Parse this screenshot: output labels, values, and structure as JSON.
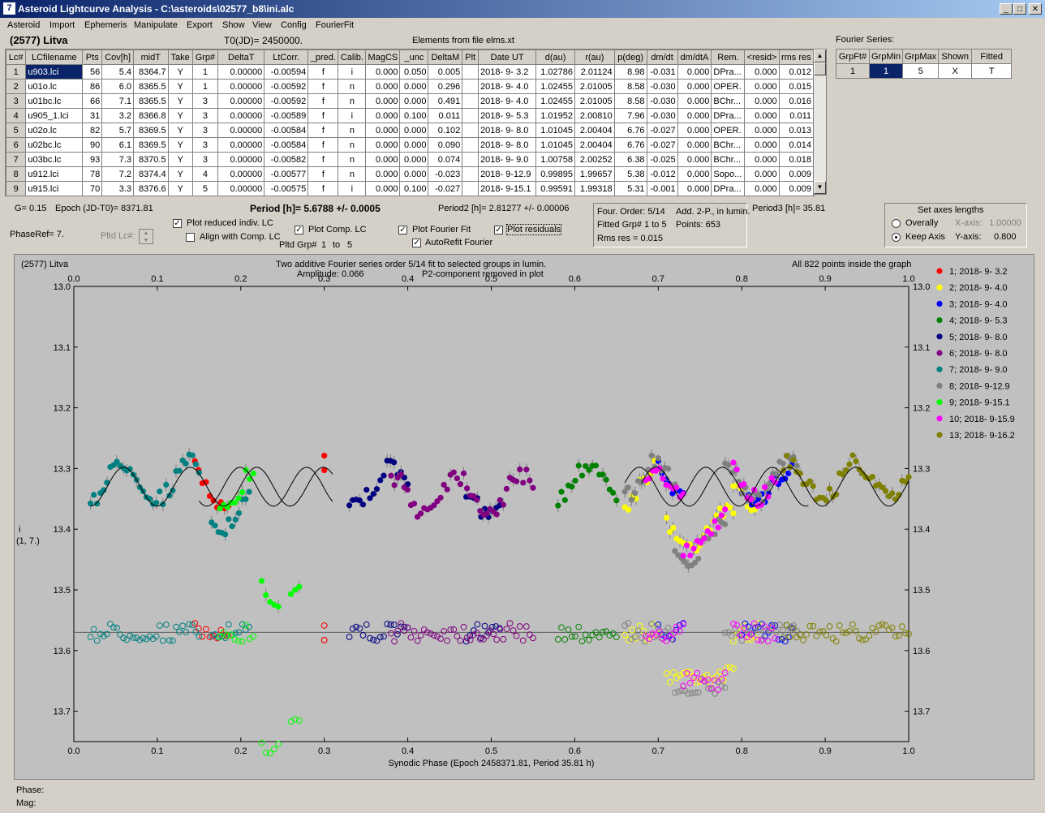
{
  "window": {
    "title": "Asteroid Lightcurve Analysis - C:\\asteroids\\02577_b8\\ini.alc",
    "icon": "7"
  },
  "menu": [
    "Asteroid",
    "Import",
    "Ephemeris",
    "Manipulate",
    "Export",
    "Show",
    "View",
    "Config",
    "FourierFit"
  ],
  "header": {
    "asteroid": "(2577) Litva",
    "t0": "T0(JD)= 2450000.",
    "elements": "Elements from file elms.xt",
    "fourier_label": "Fourier Series:"
  },
  "lc_table": {
    "columns": [
      "Lc#",
      "LCfilename",
      "Pts",
      "Cov[h]",
      "midT",
      "Take",
      "Grp#",
      "DeltaT",
      "LtCorr.",
      "_pred.",
      "Calib.",
      "MagCS",
      "_unc",
      "DeltaM",
      "Plt",
      "Date UT",
      "d(au)",
      "r(au)",
      "p(deg)",
      "dm/dt",
      "dm/dtA",
      "Rem.",
      "<resid>",
      "rms res"
    ],
    "rows": [
      [
        "1",
        "u903.lci",
        "56",
        "5.4",
        "8364.7",
        "Y",
        "1",
        "0.00000",
        "-0.00594",
        "f",
        "i",
        "0.000",
        "0.050",
        "0.005",
        "",
        "2018- 9- 3.2",
        "1.02786",
        "2.01124",
        "8.98",
        "-0.031",
        "0.000",
        "DPra...",
        "0.000",
        "0.012"
      ],
      [
        "2",
        "u01o.lc",
        "86",
        "6.0",
        "8365.5",
        "Y",
        "1",
        "0.00000",
        "-0.00592",
        "f",
        "n",
        "0.000",
        "0.000",
        "0.296",
        "",
        "2018- 9- 4.0",
        "1.02455",
        "2.01005",
        "8.58",
        "-0.030",
        "0.000",
        "OPER.",
        "0.000",
        "0.015"
      ],
      [
        "3",
        "u01bc.lc",
        "66",
        "7.1",
        "8365.5",
        "Y",
        "3",
        "0.00000",
        "-0.00592",
        "f",
        "n",
        "0.000",
        "0.000",
        "0.491",
        "",
        "2018- 9- 4.0",
        "1.02455",
        "2.01005",
        "8.58",
        "-0.030",
        "0.000",
        "BChr...",
        "0.000",
        "0.016"
      ],
      [
        "4",
        "u905_1.lci",
        "31",
        "3.2",
        "8366.8",
        "Y",
        "3",
        "0.00000",
        "-0.00589",
        "f",
        "i",
        "0.000",
        "0.100",
        "0.011",
        "",
        "2018- 9- 5.3",
        "1.01952",
        "2.00810",
        "7.96",
        "-0.030",
        "0.000",
        "DPra...",
        "0.000",
        "0.011"
      ],
      [
        "5",
        "u02o.lc",
        "82",
        "5.7",
        "8369.5",
        "Y",
        "3",
        "0.00000",
        "-0.00584",
        "f",
        "n",
        "0.000",
        "0.000",
        "0.102",
        "",
        "2018- 9- 8.0",
        "1.01045",
        "2.00404",
        "6.76",
        "-0.027",
        "0.000",
        "OPER.",
        "0.000",
        "0.013"
      ],
      [
        "6",
        "u02bc.lc",
        "90",
        "6.1",
        "8369.5",
        "Y",
        "3",
        "0.00000",
        "-0.00584",
        "f",
        "n",
        "0.000",
        "0.000",
        "0.090",
        "",
        "2018- 9- 8.0",
        "1.01045",
        "2.00404",
        "6.76",
        "-0.027",
        "0.000",
        "BChr...",
        "0.000",
        "0.014"
      ],
      [
        "7",
        "u03bc.lc",
        "93",
        "7.3",
        "8370.5",
        "Y",
        "3",
        "0.00000",
        "-0.00582",
        "f",
        "n",
        "0.000",
        "0.000",
        "0.074",
        "",
        "2018- 9- 9.0",
        "1.00758",
        "2.00252",
        "6.38",
        "-0.025",
        "0.000",
        "BChr...",
        "0.000",
        "0.018"
      ],
      [
        "8",
        "u912.lci",
        "78",
        "7.2",
        "8374.4",
        "Y",
        "4",
        "0.00000",
        "-0.00577",
        "f",
        "n",
        "0.000",
        "0.000",
        "-0.023",
        "",
        "2018- 9-12.9",
        "0.99895",
        "1.99657",
        "5.38",
        "-0.012",
        "0.000",
        "Sopo...",
        "0.000",
        "0.009"
      ],
      [
        "9",
        "u915.lci",
        "70",
        "3.3",
        "8376.6",
        "Y",
        "5",
        "0.00000",
        "-0.00575",
        "f",
        "i",
        "0.000",
        "0.100",
        "-0.027",
        "",
        "2018- 9-15.1",
        "0.99591",
        "1.99318",
        "5.31",
        "-0.001",
        "0.000",
        "DPra...",
        "0.000",
        "0.009"
      ]
    ]
  },
  "fourier_table": {
    "columns": [
      "GrpFt#",
      "GrpMin",
      "GrpMax",
      "Shown",
      "Fitted"
    ],
    "row": [
      "1",
      "1",
      "5",
      "X",
      "T"
    ]
  },
  "info": {
    "g": "G= 0.15",
    "epoch": "Epoch (JD-T0)= 8371.81",
    "period": "Period [h]= 5.6788 +/- 0.0005",
    "period2": "Period2 [h]= 2.81277 +/- 0.00006",
    "period3": "Period3 [h]= 35.81",
    "phaseref": "PhaseRef= 7.",
    "pltd_lc": "Pltd Lc#:",
    "pltd_grp": "Pltd Grp#",
    "pltd_grp_from": "1",
    "pltd_grp_to_label": "to",
    "pltd_grp_to": "5"
  },
  "checkboxes": {
    "plot_reduced": {
      "label": "Plot reduced indiv. LC",
      "checked": true
    },
    "align_comp": {
      "label": "Align with Comp. LC",
      "checked": false
    },
    "plot_comp": {
      "label": "Plot Comp. LC",
      "checked": true
    },
    "plot_fourier": {
      "label": "Plot Fourier Fit",
      "checked": true
    },
    "autorefit": {
      "label": "AutoRefit Fourier",
      "checked": true
    },
    "plot_resid": {
      "label": "Plot residuals",
      "checked": true
    }
  },
  "fourier_info": {
    "order": "Four. Order:  5/14",
    "add": "Add. 2-P., in lumin.",
    "fitted": "Fitted Grp# 1 to 5",
    "points": "Points: 653",
    "rms": "Rms res     = 0.015"
  },
  "axes_box": {
    "title": "Set axes lengths",
    "overall": "Overally",
    "keep": "Keep Axis",
    "xlabel": "X-axis:",
    "xval": "1.00000",
    "ylabel": "Y-axis:",
    "yval": "0.800",
    "selected": "keep"
  },
  "plot": {
    "title_left": "(2577) Litva",
    "title_center1": "Two additive Fourier series order 5/14 fit to selected groups in lumin.",
    "title_center2a": "Amplitude: 0.066",
    "title_center2b": "P2-component removed in plot",
    "title_right": "All 822 points inside the graph",
    "ylabel1": "i",
    "ylabel2": "(1, 7.)",
    "phase_label": "Phase:",
    "mag_label": "Mag:"
  },
  "chart_data": {
    "type": "scatter",
    "xlabel": "Synodic Phase (Epoch 2458371.81, Period 35.81 h)",
    "xlim": [
      0.0,
      1.0
    ],
    "ylim": [
      13.0,
      13.75
    ],
    "y_inverted": true,
    "x_ticks": [
      0.0,
      0.1,
      0.2,
      0.3,
      0.4,
      0.5,
      0.6,
      0.7,
      0.8,
      0.9,
      1.0
    ],
    "x_tick_labels": [
      "0.0",
      "0.1",
      "0.2",
      "0.3",
      "0.4",
      "0.5",
      "0.6",
      "0.7",
      "0.8",
      "0.9",
      "1.0"
    ],
    "y_ticks": [
      13.0,
      13.1,
      13.2,
      13.3,
      13.4,
      13.5,
      13.6,
      13.7
    ],
    "y_tick_labels": [
      "13.0",
      "13.1",
      "13.2",
      "13.3",
      "13.4",
      "13.5",
      "13.6",
      "13.7"
    ],
    "residual_baseline": 13.57,
    "legend_placement": "right",
    "series": [
      {
        "name": "1; 2018- 9- 3.2",
        "color": "#ff0000",
        "ranges": [
          [
            0.145,
            0.185,
            13.33
          ],
          [
            0.3,
            0.3,
            13.32
          ]
        ]
      },
      {
        "name": "2; 2018- 9- 4.0",
        "color": "#ffff00",
        "ranges": [
          [
            0.66,
            0.7,
            13.33
          ],
          [
            0.71,
            0.79,
            13.4
          ],
          [
            0.79,
            0.82,
            13.33
          ]
        ]
      },
      {
        "name": "3; 2018- 9- 4.0",
        "color": "#0000ff",
        "ranges": [
          [
            0.7,
            0.73,
            13.33
          ],
          [
            0.8,
            0.86,
            13.33
          ]
        ]
      },
      {
        "name": "4; 2018- 9- 5.3",
        "color": "#008000",
        "ranges": [
          [
            0.58,
            0.65,
            13.32
          ]
        ]
      },
      {
        "name": "5; 2018- 9- 8.0",
        "color": "#000080",
        "ranges": [
          [
            0.33,
            0.4,
            13.33
          ],
          [
            0.47,
            0.51,
            13.35
          ]
        ]
      },
      {
        "name": "6; 2018- 9- 8.0",
        "color": "#800080",
        "ranges": [
          [
            0.38,
            0.55,
            13.34
          ]
        ]
      },
      {
        "name": "7; 2018- 9- 9.0",
        "color": "#008080",
        "ranges": [
          [
            0.02,
            0.15,
            13.32
          ],
          [
            0.165,
            0.21,
            13.37
          ]
        ]
      },
      {
        "name": "8; 2018- 9-12.9",
        "color": "#808080",
        "ranges": [
          [
            0.66,
            0.72,
            13.32
          ],
          [
            0.72,
            0.78,
            13.42
          ],
          [
            0.78,
            0.87,
            13.32
          ]
        ]
      },
      {
        "name": "9; 2018- 9-15.1",
        "color": "#00ff00",
        "ranges": [
          [
            0.175,
            0.215,
            13.33
          ],
          [
            0.225,
            0.245,
            13.52
          ],
          [
            0.26,
            0.27,
            13.47
          ]
        ]
      },
      {
        "name": "10; 2018- 9-15.9",
        "color": "#ff00ff",
        "ranges": [
          [
            0.685,
            0.73,
            13.33
          ],
          [
            0.73,
            0.78,
            13.41
          ],
          [
            0.79,
            0.84,
            13.32
          ]
        ]
      },
      {
        "name": "13; 2018- 9-16.2",
        "color": "#808000",
        "ranges": [
          [
            0.85,
            1.0,
            13.32
          ]
        ]
      }
    ]
  }
}
